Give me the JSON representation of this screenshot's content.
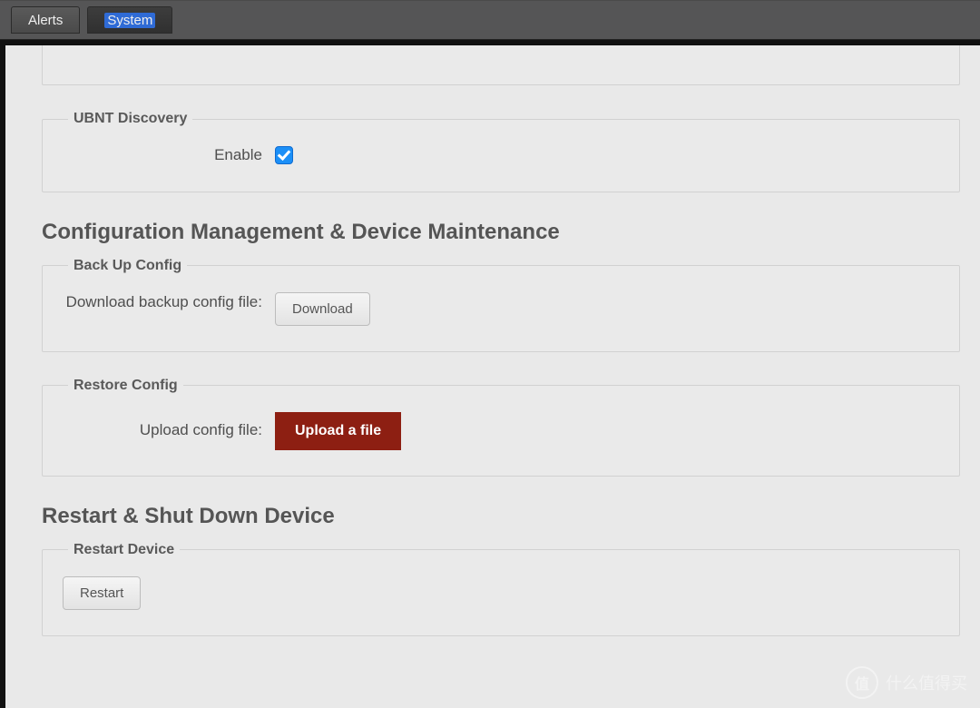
{
  "tabs": {
    "alerts": "Alerts",
    "system": "System"
  },
  "discovery": {
    "legend": "UBNT Discovery",
    "enable_label": "Enable",
    "enabled": true
  },
  "config_mgmt_heading": "Configuration Management & Device Maintenance",
  "backup": {
    "legend": "Back Up Config",
    "label": "Download backup config file:",
    "button": "Download"
  },
  "restore": {
    "legend": "Restore Config",
    "label": "Upload config file:",
    "button": "Upload a file"
  },
  "restart_heading": "Restart & Shut Down Device",
  "restart_device": {
    "legend": "Restart Device",
    "button": "Restart"
  },
  "watermark": {
    "badge": "值",
    "text": "什么值得买"
  }
}
